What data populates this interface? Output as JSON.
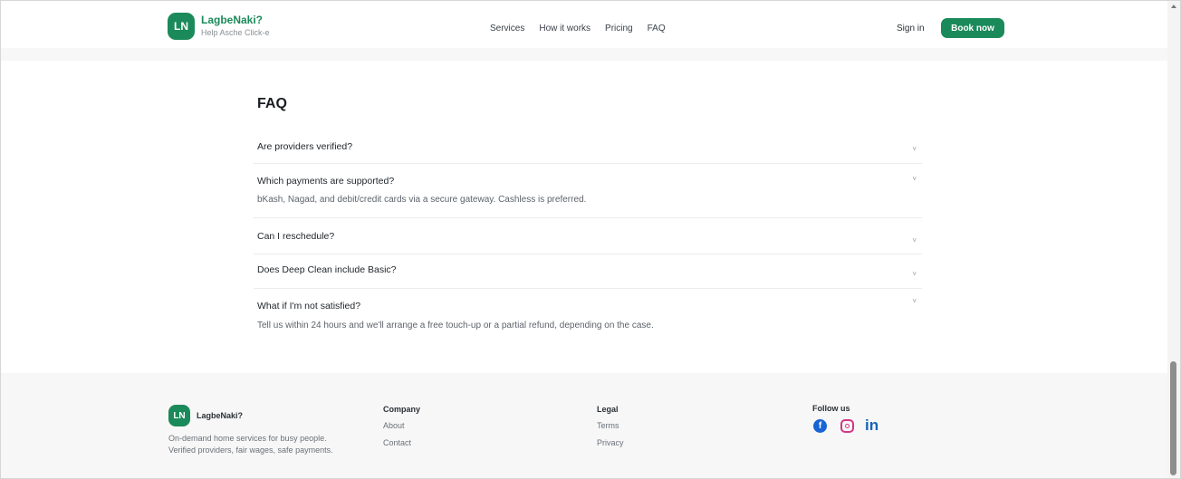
{
  "header": {
    "logo_initials": "LN",
    "brand_name": "LagbeNaki?",
    "tagline": "Help Asche Click-e",
    "nav": [
      "Services",
      "How it works",
      "Pricing",
      "FAQ"
    ],
    "sign_in": "Sign in",
    "book_now": "Book now"
  },
  "faq": {
    "title": "FAQ",
    "items": [
      {
        "question": "Are providers verified?",
        "answer": ""
      },
      {
        "question": "Which payments are supported?",
        "answer": "bKash, Nagad, and debit/credit cards via a secure gateway. Cashless is preferred."
      },
      {
        "question": "Can I reschedule?",
        "answer": ""
      },
      {
        "question": "Does Deep Clean include Basic?",
        "answer": ""
      },
      {
        "question": "What if I'm not satisfied?",
        "answer": "Tell us within 24 hours and we'll arrange a free touch-up or a partial refund, depending on the case."
      }
    ],
    "chevron": "˅"
  },
  "footer": {
    "logo_initials": "LN",
    "brand_name": "LagbeNaki?",
    "description": "On-demand home services for busy people. Verified providers, fair wages, safe payments.",
    "company": {
      "title": "Company",
      "links": [
        "About",
        "Contact"
      ]
    },
    "legal": {
      "title": "Legal",
      "links": [
        "Terms",
        "Privacy"
      ]
    },
    "follow": {
      "title": "Follow us",
      "icons": [
        "facebook-icon",
        "instagram-icon",
        "linkedin-icon"
      ],
      "linkedin_glyph": "in",
      "facebook_glyph": "f"
    }
  },
  "colors": {
    "brand_green": "#1b8a5a",
    "facebook": "#1864d6",
    "instagram": "#d43585",
    "linkedin": "#1664b8"
  }
}
